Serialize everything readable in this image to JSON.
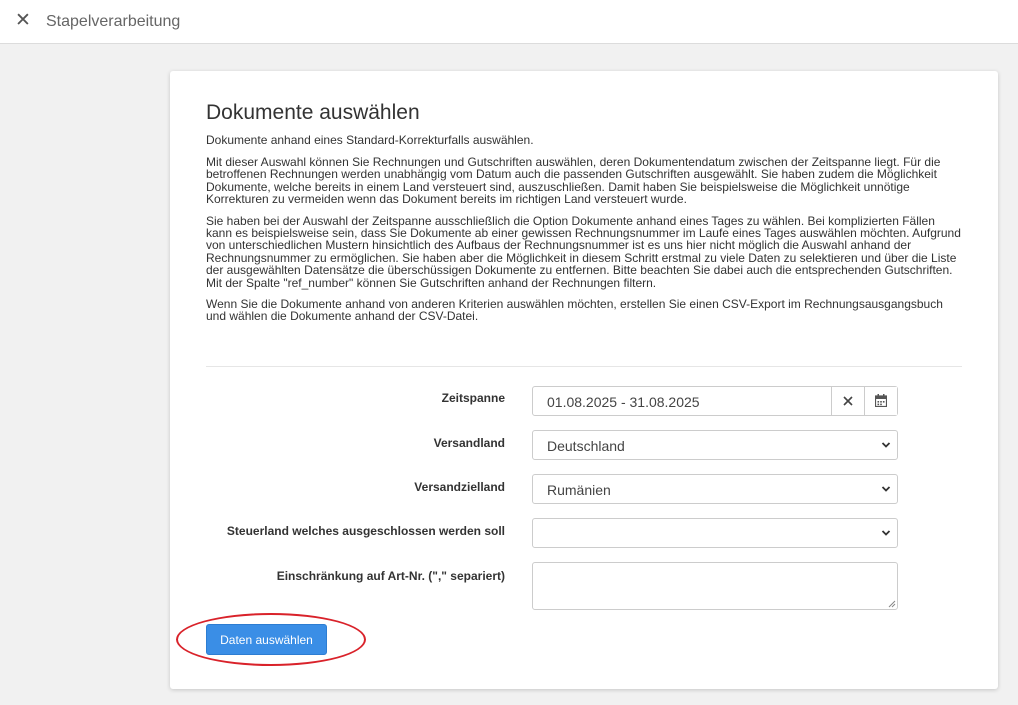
{
  "window": {
    "title": "Stapelverarbeitung",
    "close_icon": "close-icon"
  },
  "page": {
    "heading": "Dokumente auswählen",
    "intro": "Dokumente anhand eines Standard-Korrekturfalls auswählen.",
    "paragraphs": [
      "Mit dieser Auswahl können Sie Rechnungen und Gutschriften auswählen, deren Dokumentendatum zwischen der Zeitspanne liegt. Für die betroffenen Rechnungen werden unabhängig vom Datum auch die passenden Gutschriften ausgewählt. Sie haben zudem die Möglichkeit Dokumente, welche bereits in einem Land versteuert sind, auszuschließen. Damit haben Sie beispielsweise die Möglichkeit unnötige Korrekturen zu vermeiden wenn das Dokument bereits im richtigen Land versteuert wurde.",
      "Sie haben bei der Auswahl der Zeitspanne ausschließlich die Option Dokumente anhand eines Tages zu wählen. Bei komplizierten Fällen kann es beispielsweise sein, dass Sie Dokumente ab einer gewissen Rechnungsnummer im Laufe eines Tages auswählen möchten. Aufgrund von unterschiedlichen Mustern hinsichtlich des Aufbaus der Rechnungsnummer ist es uns hier nicht möglich die Auswahl anhand der Rechnungsnummer zu ermöglichen. Sie haben aber die Möglichkeit in diesem Schritt erstmal zu viele Daten zu selektieren und über die Liste der ausgewählten Datensätze die überschüssigen Dokumente zu entfernen. Bitte beachten Sie dabei auch die entsprechenden Gutschriften. Mit der Spalte \"ref_number\" können Sie Gutschriften anhand der Rechnungen filtern.",
      "Wenn Sie die Dokumente anhand von anderen Kriterien auswählen möchten, erstellen Sie einen CSV-Export im Rechnungsausgangsbuch und wählen die Dokumente anhand der CSV-Datei."
    ]
  },
  "form": {
    "period": {
      "label": "Zeitspanne",
      "value": "01.08.2025 - 31.08.2025",
      "clear_icon": "close-icon",
      "calendar_icon": "calendar-icon"
    },
    "shipping_country": {
      "label": "Versandland",
      "value": "Deutschland"
    },
    "destination_country": {
      "label": "Versandzielland",
      "value": "Rumänien"
    },
    "excluded_tax_country": {
      "label": "Steuerland welches ausgeschlossen werden soll",
      "value": ""
    },
    "article_filter": {
      "label": "Einschränkung auf Art-Nr. (\",\" separiert)",
      "value": ""
    },
    "submit_label": "Daten auswählen"
  },
  "colors": {
    "primary_button": "#3a8ee6",
    "highlight_ring": "#d9222a",
    "background": "#f1f1f1"
  }
}
